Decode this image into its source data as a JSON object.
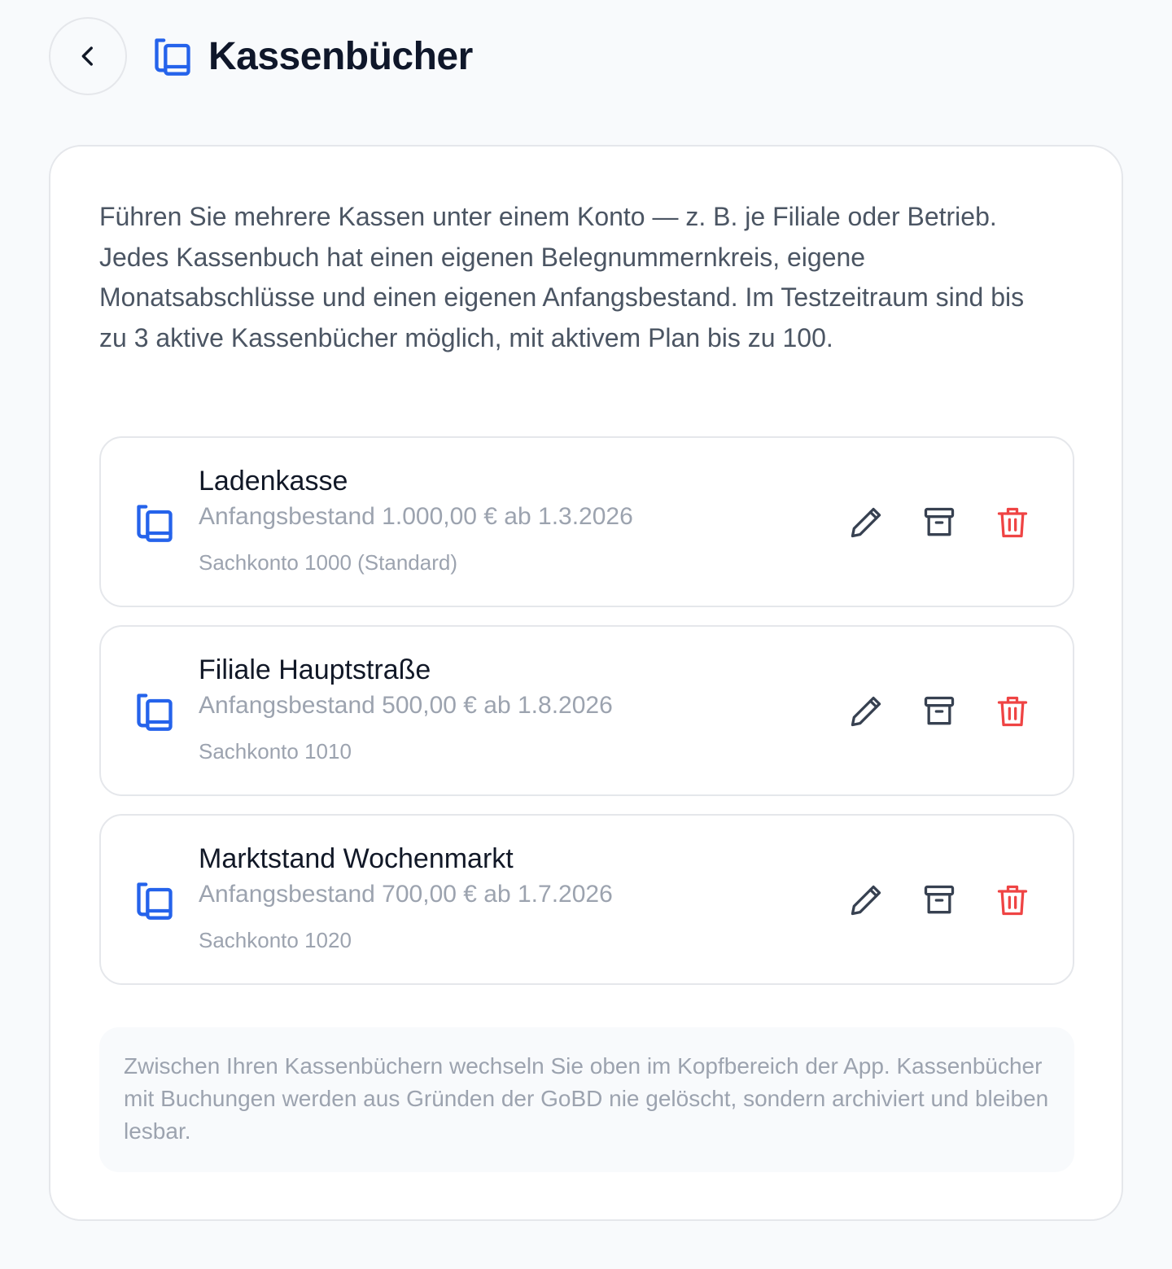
{
  "header": {
    "title": "Kassenbücher",
    "back_icon": "chevron-left-icon",
    "title_icon": "books-icon"
  },
  "intro": "Führen Sie mehrere Kassen unter einem Konto — z. B. je Filiale oder Betrieb. Jedes Kassenbuch hat einen eigenen Belegnummernkreis, eigene Monatsabschlüsse und einen eigenen Anfangsbestand. Im Testzeitraum sind bis zu 3 aktive Kassenbücher möglich, mit aktivem Plan bis zu 100.",
  "books": [
    {
      "name": "Ladenkasse",
      "balance": "Anfangsbestand 1.000,00 € ab 1.3.2026",
      "account": "Sachkonto 1000 (Standard)"
    },
    {
      "name": "Filiale Hauptstraße",
      "balance": "Anfangsbestand 500,00 € ab 1.8.2026",
      "account": "Sachkonto 1010"
    },
    {
      "name": "Marktstand Wochenmarkt",
      "balance": "Anfangsbestand 700,00 € ab 1.7.2026",
      "account": "Sachkonto 1020"
    }
  ],
  "actions": {
    "edit_icon": "pencil-icon",
    "archive_icon": "archive-icon",
    "delete_icon": "trash-icon"
  },
  "note": "Zwischen Ihren Kassenbüchern wechseln Sie oben im Kopfbereich der App. Kassenbücher mit Buchungen werden aus Gründen der GoBD nie gelöscht, sondern archiviert und bleiben lesbar.",
  "colors": {
    "accent": "#2563eb",
    "danger": "#ef4444",
    "icon": "#374151",
    "muted_text": "#9ca3af",
    "body_text": "#4b5563"
  }
}
